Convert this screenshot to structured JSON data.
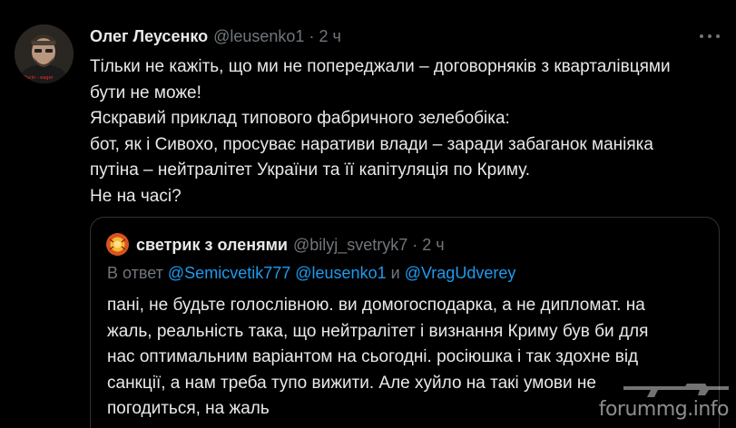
{
  "tweet": {
    "author_name": "Олег Леусенко",
    "author_handle": "@leusenko1",
    "separator": "·",
    "time": "2 ч",
    "avatar_caption": "Pacin - eager",
    "text_lines": [
      "Тільки не кажіть, що ми не попереджали – договорняків з кварталівцями",
      "бути не може!",
      "Яскравий приклад типового фабричного зелебобіка:",
      "бот, як і Сивохо, просуває наративи влади – заради забаганок маніяка",
      "путіна – нейтралітет України та її капітуляція по Криму.",
      "Не на часі?"
    ]
  },
  "quote": {
    "author_name": "светрик з оленями",
    "author_handle": "@bilyj_svetryk7",
    "separator": "·",
    "time": "2 ч",
    "reply_prefix": "В ответ",
    "mentions": [
      "@Semicvetik777",
      "@leusenko1",
      "@VragUdverey"
    ],
    "mention_joiner": "и",
    "text_lines": [
      "пані, не будьте голослівною. ви домогосподарка, а не дипломат. на",
      "жаль, реальність така, що нейтралітет і визнання Криму був би для",
      "нас оптимальним варіантом на сьогодні. росіюшка і так здохне від",
      "санкції, а нам треба тупо вижити. Але хуйло на такі умови не",
      "погодиться, на жаль"
    ]
  },
  "watermark": "forummg.info",
  "colors": {
    "background": "#000000",
    "text": "#e7e9ea",
    "muted": "#71767b",
    "link": "#1d9bf0",
    "border": "#2f3336"
  }
}
